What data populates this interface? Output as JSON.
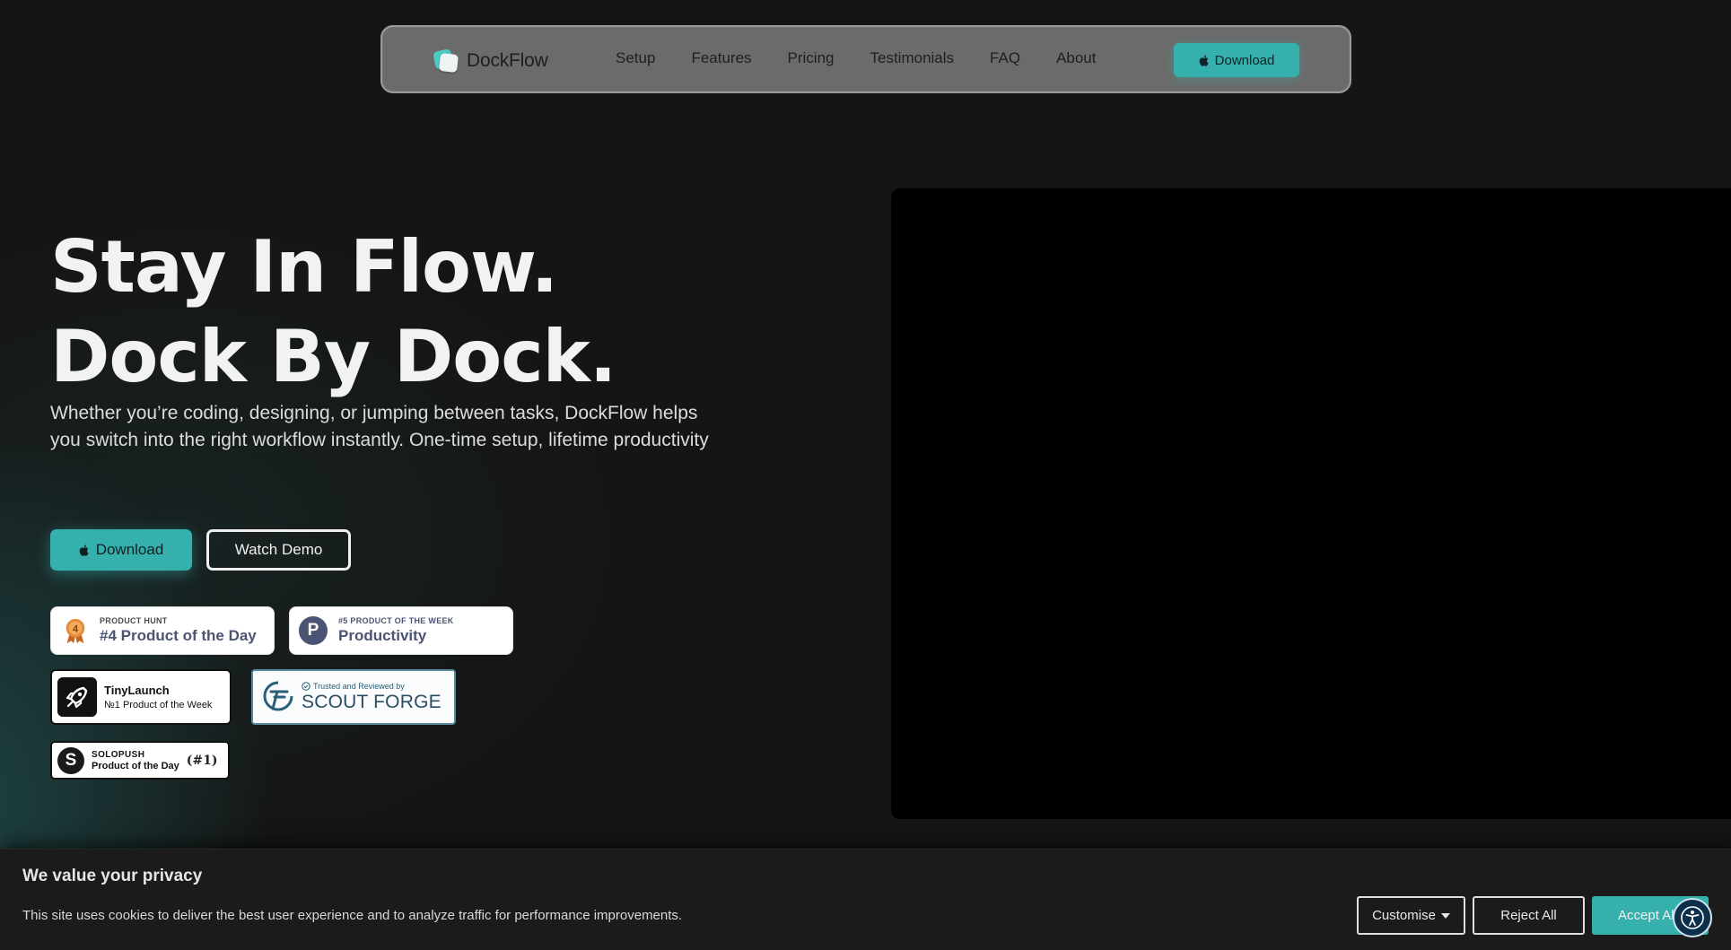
{
  "nav": {
    "logo_text": "DockFlow",
    "links": [
      "Setup",
      "Features",
      "Pricing",
      "Testimonials",
      "FAQ",
      "About"
    ],
    "download_label": "Download"
  },
  "hero": {
    "title_line1": "Stay In Flow.",
    "title_line2": "Dock By Dock.",
    "subtitle": "Whether you’re coding, designing, or jumping between tasks, DockFlow helps you switch into the right workflow instantly. One-time setup, lifetime productivity",
    "download_label": "Download",
    "demo_label": "Watch Demo"
  },
  "badges": {
    "product_hunt_day": {
      "small": "PRODUCT HUNT",
      "big": "#4 Product of the Day",
      "medal": "4"
    },
    "product_hunt_week": {
      "small": "#5 PRODUCT OF THE WEEK",
      "big": "Productivity",
      "letter": "P"
    },
    "tinylaunch": {
      "title": "TinyLaunch",
      "sub": "№1 Product of the Week"
    },
    "scout_forge": {
      "small": "Trusted and Reviewed by",
      "big": "SCOUT FORGE"
    },
    "solopush": {
      "small": "SOLOPUSH",
      "big": "Product of the Day",
      "rank": "#1",
      "letter": "S"
    }
  },
  "cookie": {
    "title": "We value your privacy",
    "text": "This site uses cookies to deliver the best user experience and to analyze traffic for performance improvements.",
    "customise_label": "Customise",
    "reject_label": "Reject All",
    "accept_label": "Accept All"
  },
  "colors": {
    "accent": "#36b0ad",
    "background": "#151515",
    "nav_bg": "#6b6b6b"
  }
}
